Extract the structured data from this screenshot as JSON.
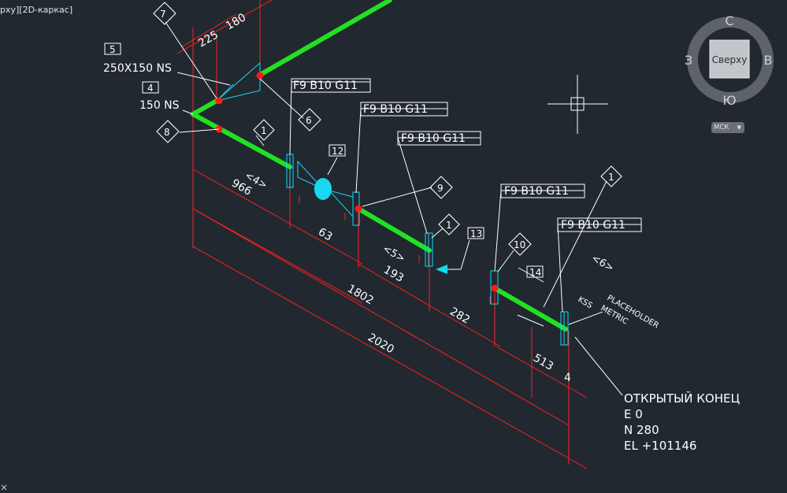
{
  "viewport_label": "рху][2D-каркас]",
  "viewcube": {
    "north": "С",
    "south": "Ю",
    "east": "В",
    "west": "З",
    "face": "Сверху",
    "wcs_label": "МСК"
  },
  "drawing": {
    "weld_tags": {
      "f1": "F9 B10 G11",
      "f2": "F9 B10 G11",
      "f3": "F9 B10 G11",
      "f4": "F9 B10 G11",
      "f5": "F9 B10 G11"
    },
    "balloons": {
      "b7": "7",
      "b8": "8",
      "b6": "6",
      "b9": "9",
      "b10": "10",
      "b1a": "1",
      "b1b": "1",
      "b1c": "1"
    },
    "boxes": {
      "n5": "5",
      "n4": "4",
      "n12": "12",
      "n13": "13",
      "n14": "14"
    },
    "size_labels": {
      "reducer": "250X150 NS",
      "pipe": "150 NS"
    },
    "spool_labels": {
      "s4": "<4>",
      "s5": "<5>",
      "s6": "<6>"
    },
    "dimensions": {
      "d225": "225",
      "d180": "180",
      "d966": "966",
      "d63": "63",
      "d193": "193",
      "d1802": "1802",
      "d282": "282",
      "d2020": "2020",
      "d513": "513",
      "d4": "4"
    },
    "placeholder": {
      "kss": "KSS",
      "placeholder": "PLACEHOLDER",
      "metric": "METRIC"
    },
    "open_end": {
      "title": "ОТКРЫТЫЙ КОНЕЦ",
      "e": "E 0",
      "n": "N 280",
      "el": "EL +101146"
    }
  },
  "colors": {
    "background": "#212830",
    "pipe": "#22e022",
    "dimension": "#ff2020",
    "fitting": "#18d8f0",
    "annotation": "#ffffff",
    "weld_point": "#ff1a1a"
  }
}
